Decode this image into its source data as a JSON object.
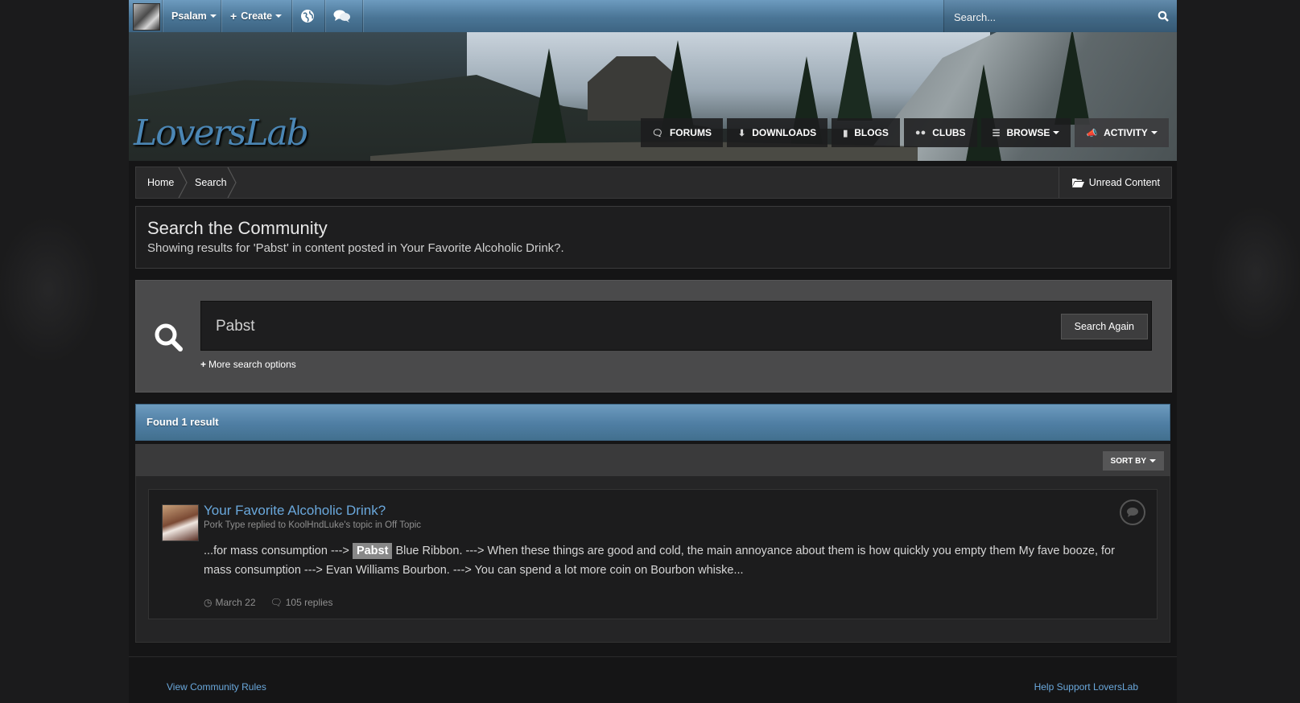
{
  "userbar": {
    "username": "Psalam",
    "create_label": "Create",
    "search_placeholder": "Search..."
  },
  "header": {
    "logo_text": "LoversLab",
    "nav": [
      {
        "label": "FORUMS",
        "icon": "comments-icon"
      },
      {
        "label": "DOWNLOADS",
        "icon": "download-icon"
      },
      {
        "label": "BLOGS",
        "icon": "book-icon"
      },
      {
        "label": "CLUBS",
        "icon": "users-icon"
      },
      {
        "label": "BROWSE",
        "icon": "list-icon"
      },
      {
        "label": "ACTIVITY",
        "icon": "bullhorn-icon"
      }
    ]
  },
  "breadcrumb": {
    "items": [
      "Home",
      "Search"
    ],
    "unread_label": "Unread Content"
  },
  "page": {
    "title": "Search the Community",
    "subtitle": "Showing results for 'Pabst' in content posted in Your Favorite Alcoholic Drink?."
  },
  "search": {
    "query": "Pabst",
    "button_label": "Search Again",
    "more_options": "More search options"
  },
  "results": {
    "header": "Found 1 result",
    "sort_label": "SORT BY",
    "items": [
      {
        "title": "Your Favorite Alcoholic Drink?",
        "meta": "Pork Type replied to KoolHndLuke's topic in Off Topic",
        "snippet_before": "...for mass consumption --->",
        "snippet_highlight": "Pabst",
        "snippet_after": "Blue Ribbon. ---> When these things are good and cold, the main annoyance about them is how quickly you empty them My fave booze, for mass consumption ---> Evan Williams Bourbon. ---> You can spend a lot more coin on Bourbon whiske...",
        "date": "March 22",
        "replies": "105 replies"
      }
    ]
  },
  "footer": {
    "left_link": "View Community Rules",
    "right_link": "Help Support LoversLab"
  },
  "colors": {
    "accent_blue": "#4f7ea3",
    "link_blue": "#6aa8dc",
    "background": "#1b1b1c"
  }
}
